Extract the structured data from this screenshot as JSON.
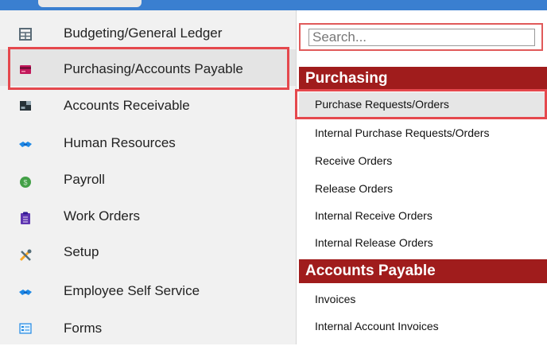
{
  "sidebar": {
    "items": [
      {
        "label": "Budgeting/General Ledger",
        "icon": "ledger-grid-icon",
        "color": "#5a6b77"
      },
      {
        "label": "Purchasing/Accounts Payable",
        "icon": "credit-card-icon",
        "color": "#c2185b",
        "selected": true
      },
      {
        "label": "Accounts Receivable",
        "icon": "register-icon",
        "color": "#263238"
      },
      {
        "label": "Human Resources",
        "icon": "handshake-icon",
        "color": "#1e88e5"
      },
      {
        "label": "Payroll",
        "icon": "money-bag-icon",
        "color": "#43a047"
      },
      {
        "label": "Work Orders",
        "icon": "clipboard-icon",
        "color": "#5e35b1"
      },
      {
        "label": "Setup",
        "icon": "tools-icon",
        "color": "#f9a825"
      },
      {
        "label": "Employee Self Service",
        "icon": "handshake-icon",
        "color": "#1e88e5"
      },
      {
        "label": "Forms",
        "icon": "form-icon",
        "color": "#1e88e5"
      }
    ]
  },
  "panel": {
    "search": {
      "placeholder": "Search..."
    },
    "sections": [
      {
        "title": "Purchasing",
        "items": [
          "Purchase Requests/Orders",
          "Internal Purchase Requests/Orders",
          "Receive Orders",
          "Release Orders",
          "Internal Receive Orders",
          "Internal Release Orders"
        ]
      },
      {
        "title": "Accounts Payable",
        "items": [
          "Invoices",
          "Internal Account Invoices"
        ]
      }
    ]
  },
  "colors": {
    "accent_blue": "#3a7fd0",
    "section_red": "#a01c1c",
    "highlight_red": "#e5484d"
  }
}
